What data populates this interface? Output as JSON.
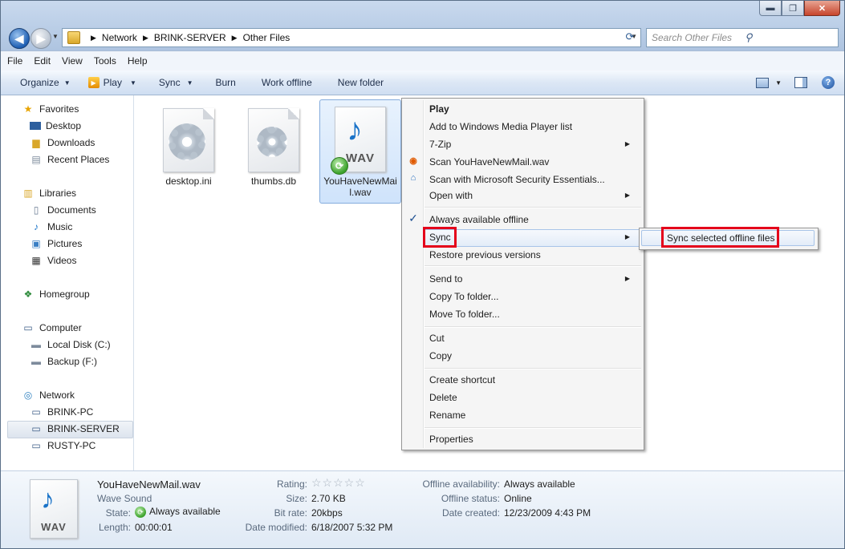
{
  "window": {
    "caption_buttons": {
      "minimize": "▬",
      "maximize": "❐",
      "close": "✕"
    }
  },
  "address": {
    "crumbs": [
      "Network",
      "BRINK-SERVER",
      "Other Files"
    ],
    "search_placeholder": "Search Other Files"
  },
  "menubar": [
    "File",
    "Edit",
    "View",
    "Tools",
    "Help"
  ],
  "toolbar": {
    "organize": "Organize",
    "play": "Play",
    "sync": "Sync",
    "burn": "Burn",
    "work_offline": "Work offline",
    "new_folder": "New folder"
  },
  "sidebar": {
    "favorites": "Favorites",
    "desktop": "Desktop",
    "downloads": "Downloads",
    "recent_places": "Recent Places",
    "libraries": "Libraries",
    "documents": "Documents",
    "music": "Music",
    "pictures": "Pictures",
    "videos": "Videos",
    "homegroup": "Homegroup",
    "computer": "Computer",
    "local_disk": "Local Disk (C:)",
    "backup": "Backup (F:)",
    "network": "Network",
    "brink_pc": "BRINK-PC",
    "brink_server": "BRINK-SERVER",
    "rusty_pc": "RUSTY-PC"
  },
  "files": [
    {
      "name": "desktop.ini"
    },
    {
      "name": "thumbs.db"
    },
    {
      "name_line1": "YouHaveNewMai",
      "name_line2": "l.wav",
      "icon_label": "WAV"
    }
  ],
  "context_menu": {
    "play": "Play",
    "add_wmp": "Add to Windows Media Player list",
    "seven_zip": "7-Zip",
    "scan": "Scan YouHaveNewMail.wav",
    "scan_mse": "Scan with Microsoft Security Essentials...",
    "open_with": "Open with",
    "always_offline": "Always available offline",
    "sync": "Sync",
    "restore": "Restore previous versions",
    "send_to": "Send to",
    "copy_to": "Copy To folder...",
    "move_to": "Move To folder...",
    "cut": "Cut",
    "copy": "Copy",
    "create_shortcut": "Create shortcut",
    "delete": "Delete",
    "rename": "Rename",
    "properties": "Properties"
  },
  "submenu": {
    "sync_selected": "Sync selected offline files"
  },
  "details": {
    "filename": "YouHaveNewMail.wav",
    "type": "Wave Sound",
    "icon_label": "WAV",
    "state_label": "State:",
    "state_value": "Always available",
    "length_label": "Length:",
    "length_value": "00:00:01",
    "rating_label": "Rating:",
    "rating_stars": "☆☆☆☆☆",
    "size_label": "Size:",
    "size_value": "2.70 KB",
    "bitrate_label": "Bit rate:",
    "bitrate_value": "20kbps",
    "date_modified_label": "Date modified:",
    "date_modified_value": "6/18/2007 5:32 PM",
    "offline_avail_label": "Offline availability:",
    "offline_avail_value": "Always available",
    "offline_status_label": "Offline status:",
    "offline_status_value": "Online",
    "date_created_label": "Date created:",
    "date_created_value": "12/23/2009 4:43 PM"
  },
  "colors": {
    "highlight_box": "#e4001b",
    "accent": "#1a73c8"
  }
}
